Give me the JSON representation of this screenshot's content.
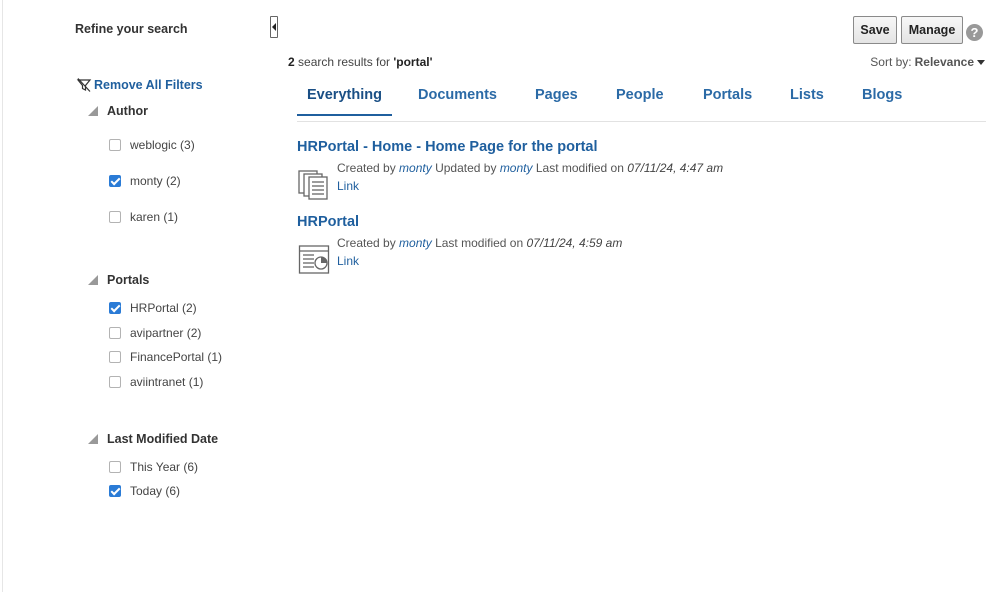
{
  "sidebar": {
    "title": "Refine your search",
    "remove_filters": "Remove All Filters",
    "facets": [
      {
        "title": "Author",
        "options": [
          {
            "label": "weblogic (3)",
            "checked": false
          },
          {
            "label": "monty (2)",
            "checked": true
          },
          {
            "label": "karen (1)",
            "checked": false
          }
        ]
      },
      {
        "title": "Portals",
        "options": [
          {
            "label": "HRPortal (2)",
            "checked": true
          },
          {
            "label": "avipartner (2)",
            "checked": false
          },
          {
            "label": "FinancePortal (1)",
            "checked": false
          },
          {
            "label": "aviintranet (1)",
            "checked": false
          }
        ]
      },
      {
        "title": "Last Modified Date",
        "options": [
          {
            "label": "This Year (6)",
            "checked": false
          },
          {
            "label": "Today (6)",
            "checked": true
          }
        ]
      }
    ]
  },
  "toolbar": {
    "save_label": "Save",
    "manage_label": "Manage",
    "help_label": "?"
  },
  "results_summary": {
    "count": "2",
    "text": " search results for ",
    "query": "'portal'"
  },
  "sort": {
    "label": "Sort by:",
    "value": "Relevance"
  },
  "tabs": [
    {
      "label": "Everything",
      "active": true
    },
    {
      "label": "Documents",
      "active": false
    },
    {
      "label": "Pages",
      "active": false
    },
    {
      "label": "People",
      "active": false
    },
    {
      "label": "Portals",
      "active": false
    },
    {
      "label": "Lists",
      "active": false
    },
    {
      "label": "Blogs",
      "active": false
    }
  ],
  "results": [
    {
      "title": "HRPortal - Home - Home Page for the portal",
      "icon": "pages-stack-icon",
      "created_prefix": "Created by",
      "created_by": "monty",
      "updated_prefix": "Updated by",
      "updated_by": "monty",
      "modified_prefix": "Last modified on",
      "modified": "07/11/24, 4:47 am",
      "link": "Link"
    },
    {
      "title": "HRPortal",
      "icon": "portal-page-icon",
      "created_prefix": "Created by",
      "created_by": "monty",
      "modified_prefix": "Last modified on",
      "modified": "07/11/24, 4:59 am",
      "link": "Link"
    }
  ],
  "colors": {
    "accent": "#1f5f9e",
    "checkbox": "#2a7bd6"
  }
}
